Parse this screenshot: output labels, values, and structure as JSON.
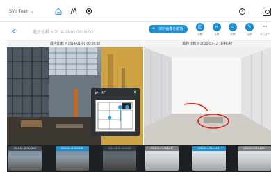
{
  "header": {
    "team_name": "SV's Team",
    "help_label": "?"
  },
  "subheader": {
    "back_label": "<",
    "breadcrumb": "進捗比較 > 2014-01-01 00:06:50",
    "add_photo_label": "360°画像を追加",
    "tools": [
      {
        "label": "比較",
        "icon": "compare-icon"
      },
      {
        "label": "共有",
        "icon": "share-icon"
      },
      {
        "label": "計測",
        "icon": "measure-icon"
      },
      {
        "label": "注釈",
        "icon": "annotate-icon"
      },
      {
        "label": "メニュー",
        "icon": "more-icon"
      }
    ]
  },
  "left_pane": {
    "header": "進捗比較 > 2014-01-01 00:06:50"
  },
  "right_pane": {
    "header": "進捗比較 > 2015-07-13 18:46:47"
  },
  "minimap": {
    "title": "4F"
  },
  "filmstrip": {
    "thumbs": [
      {
        "date": "2014-01-01 00:06:50"
      },
      {
        "date": "2014-01-01 00:06:50"
      },
      {
        "date": "2014-01-01 00:06:50"
      },
      {
        "date": "2015-07-13 18:46:47"
      },
      {
        "date": "2015-07-13 18:46:47"
      },
      {
        "date": "2015-07-13 18:46:47"
      }
    ]
  },
  "colors": {
    "accent": "#1f8ecf",
    "annotation": "#e02020"
  }
}
